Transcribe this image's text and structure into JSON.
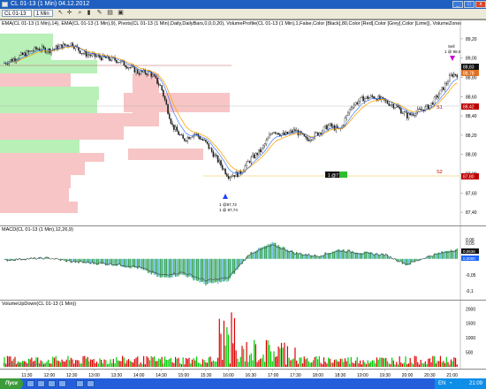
{
  "window": {
    "title": "CL 01-13 (1 Min)  04.12.2012",
    "min": "_",
    "max": "□",
    "close": "x"
  },
  "toolbar": {
    "instrument": "CL 01-13",
    "interval": "1 Min",
    "icons": [
      "pointer-icon",
      "crosshair-icon",
      "zoom-icon",
      "bar-style-icon",
      "draw-icon",
      "properties-icon",
      "lock-icon"
    ]
  },
  "price_panel": {
    "indicators": "EMA(CL 01-13 (1 Min),14), EMA(CL 01-13 (1 Min),9), Pivots(CL 01-13 (1 Min),Daily,DailyBars,0,0,0,20), VolumeProfile(CL 01-13 (1 Min),1,False,Color [Black],80,Color [Red],Color [Grey],Color [Lime]), VolumeZones(CL 01-13 (1 Min),Color [Red],Co",
    "axis_labels": [
      "89,20",
      "89,00",
      "88,80",
      "88,60",
      "88,40",
      "88,20",
      "88,00",
      "87,80",
      "87,60",
      "87,40"
    ],
    "level_s1": "S1",
    "level_s2": "S2",
    "price_s1": "88,42",
    "price_s2": "87,80",
    "price_last": "88,83",
    "price_last2": "88,78",
    "low_marker_a": "1",
    "low_marker_b": "@87,72",
    "low_marker_c": "1 @ 87,74",
    "sell_a": "Sell",
    "sell_b": "1 @ 88,9",
    "order_qty": "1 @7"
  },
  "macd_panel": {
    "title": "MACD(CL 01-13 (1 Min),12,26,9)",
    "axis_labels": [
      "0,06",
      "0,05",
      "0",
      "-0,05",
      "-0,1"
    ],
    "value_a": "0,0636",
    "value_b": "0,0000"
  },
  "volume_panel": {
    "title": "VolumeUpDown(CL 01-13 (1 Min))",
    "axis_labels": [
      "2000",
      "1500",
      "1000",
      "500"
    ],
    "credit": "© 2012 NinjaTrader, LLC"
  },
  "time_axis": [
    "11:30",
    "12:00",
    "12:30",
    "13:00",
    "13:30",
    "14:00",
    "14:30",
    "15:00",
    "15:30",
    "16:00",
    "16:30",
    "17:00",
    "17:30",
    "18:00",
    "18:30",
    "19:00",
    "19:30",
    "20:00",
    "20:30",
    "21:00"
  ],
  "taskbar": {
    "start": "Пуск",
    "lang": "EN",
    "clock": "21:09"
  },
  "colors": {
    "up": "#00cc00",
    "down": "#dd0000",
    "ema14": "#ffa500",
    "ema9": "#1e64ff",
    "profile_green": "#b8f0b8",
    "profile_red": "#f7c5c5"
  },
  "chart_data": {
    "type": "candlestick",
    "title": "CL 01-13 (1 Min)",
    "price_ylim": [
      87.3,
      89.3
    ],
    "price_path": [
      [
        "11:00",
        88.95
      ],
      [
        "11:15",
        89.0
      ],
      [
        "11:30",
        89.05
      ],
      [
        "11:45",
        89.1
      ],
      [
        "12:00",
        89.08
      ],
      [
        "12:15",
        89.12
      ],
      [
        "12:30",
        89.15
      ],
      [
        "12:45",
        89.05
      ],
      [
        "13:00",
        89.02
      ],
      [
        "13:15",
        89.0
      ],
      [
        "13:30",
        88.98
      ],
      [
        "13:45",
        88.92
      ],
      [
        "14:00",
        88.85
      ],
      [
        "14:15",
        88.85
      ],
      [
        "14:30",
        88.7
      ],
      [
        "14:45",
        88.3
      ],
      [
        "15:00",
        88.15
      ],
      [
        "15:15",
        88.22
      ],
      [
        "15:30",
        88.12
      ],
      [
        "15:45",
        87.95
      ],
      [
        "16:00",
        87.78
      ],
      [
        "16:15",
        87.8
      ],
      [
        "16:30",
        87.95
      ],
      [
        "16:45",
        88.05
      ],
      [
        "17:00",
        88.25
      ],
      [
        "17:15",
        88.2
      ],
      [
        "17:30",
        88.25
      ],
      [
        "17:45",
        88.15
      ],
      [
        "18:00",
        88.22
      ],
      [
        "18:15",
        88.3
      ],
      [
        "18:30",
        88.25
      ],
      [
        "18:45",
        88.5
      ],
      [
        "19:00",
        88.58
      ],
      [
        "19:15",
        88.6
      ],
      [
        "19:30",
        88.55
      ],
      [
        "19:45",
        88.5
      ],
      [
        "20:00",
        88.4
      ],
      [
        "20:15",
        88.45
      ],
      [
        "20:30",
        88.5
      ],
      [
        "20:45",
        88.65
      ],
      [
        "21:00",
        88.83
      ]
    ],
    "macd_ylim": [
      -0.12,
      0.08
    ],
    "macd_path": [
      [
        "11:00",
        -0.005
      ],
      [
        "11:30",
        0.0
      ],
      [
        "12:00",
        0.003
      ],
      [
        "12:30",
        -0.01
      ],
      [
        "13:00",
        -0.015
      ],
      [
        "13:30",
        -0.02
      ],
      [
        "14:00",
        -0.03
      ],
      [
        "14:30",
        -0.06
      ],
      [
        "15:00",
        -0.05
      ],
      [
        "15:30",
        -0.08
      ],
      [
        "16:00",
        -0.07
      ],
      [
        "16:30",
        0.02
      ],
      [
        "17:00",
        0.05
      ],
      [
        "17:30",
        0.02
      ],
      [
        "18:00",
        0.01
      ],
      [
        "18:30",
        0.03
      ],
      [
        "19:00",
        0.02
      ],
      [
        "19:30",
        0.015
      ],
      [
        "20:00",
        -0.02
      ],
      [
        "20:30",
        0.01
      ],
      [
        "21:00",
        0.03
      ]
    ],
    "volume_ylim": [
      0,
      2100
    ]
  }
}
